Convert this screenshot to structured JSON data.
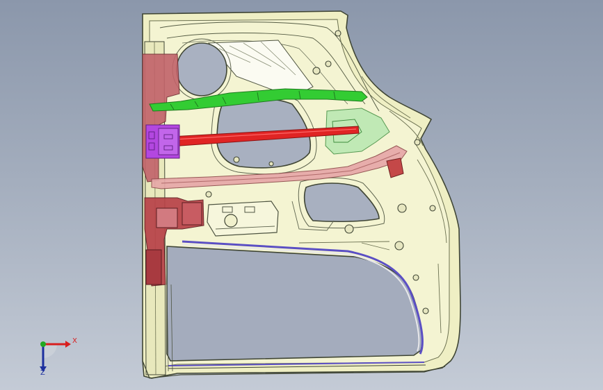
{
  "viewport": {
    "description_free": true
  },
  "triad": {
    "x_label": "X",
    "z_label": "Z"
  },
  "colors": {
    "background_top": "#8b97ab",
    "background_bottom": "#c4cbd6",
    "door_panel": "#efefc4",
    "door_edge": "#3f4534",
    "hinge_reinforcement": "#b5555a",
    "green_rail": "#33cc33",
    "red_bar": "#e02424",
    "pink_bracket": "#e6a8a8",
    "purple_bracket": "#b347e0",
    "glass_run": "#5b4fc4",
    "axis_x": "#d81e1e",
    "axis_y": "#22a822",
    "axis_z": "#1c2f9e"
  }
}
